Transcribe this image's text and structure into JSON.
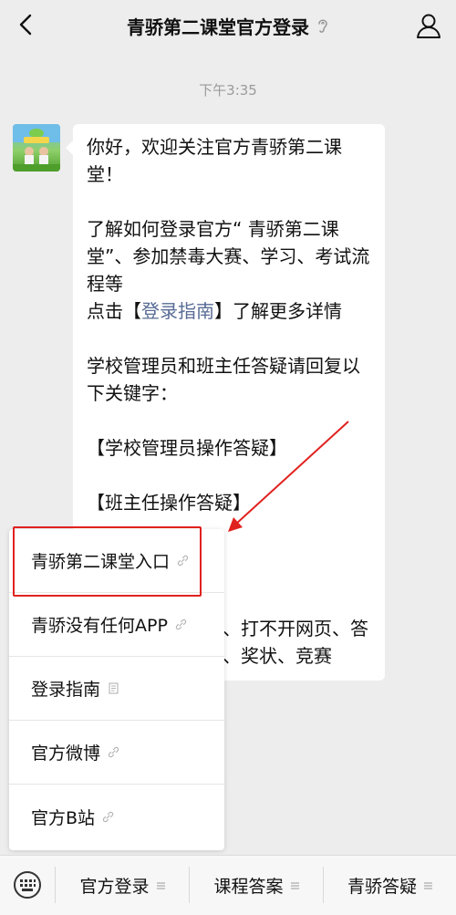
{
  "header": {
    "title": "青骄第二课堂官方登录"
  },
  "chat": {
    "timestamp": "下午3:35",
    "message": {
      "para1": "你好，欢迎关注官方青骄第二课堂！",
      "para2": "了解如何登录官方“ 青骄第二课堂”、参加禁毒大赛、学习、考试流程等",
      "para3_prefix": "点击【",
      "para3_link": "登录指南",
      "para3_suffix": "】了解更多详情",
      "para4": "学校管理员和班主任答疑请回复以下关键字：",
      "para5": "【学校管理员操作答疑】",
      "para6": "【班主任操作答疑】",
      "tail_line1": "、打不开网页、答",
      "tail_line2": "、奖状、竞赛"
    }
  },
  "menu": {
    "items": [
      {
        "label": "青骄第二课堂入口",
        "icon": "link-icon"
      },
      {
        "label": "青骄没有任何APP",
        "icon": "link-icon"
      },
      {
        "label": "登录指南",
        "icon": "article-icon"
      },
      {
        "label": "官方微博",
        "icon": "link-icon"
      },
      {
        "label": "官方B站",
        "icon": "link-icon"
      }
    ]
  },
  "footer": {
    "tabs": [
      {
        "label": "官方登录"
      },
      {
        "label": "课程答案"
      },
      {
        "label": "青骄答疑"
      }
    ]
  },
  "colors": {
    "background": "#ededed",
    "link": "#576b95",
    "annotation_red": "#e0221f"
  }
}
